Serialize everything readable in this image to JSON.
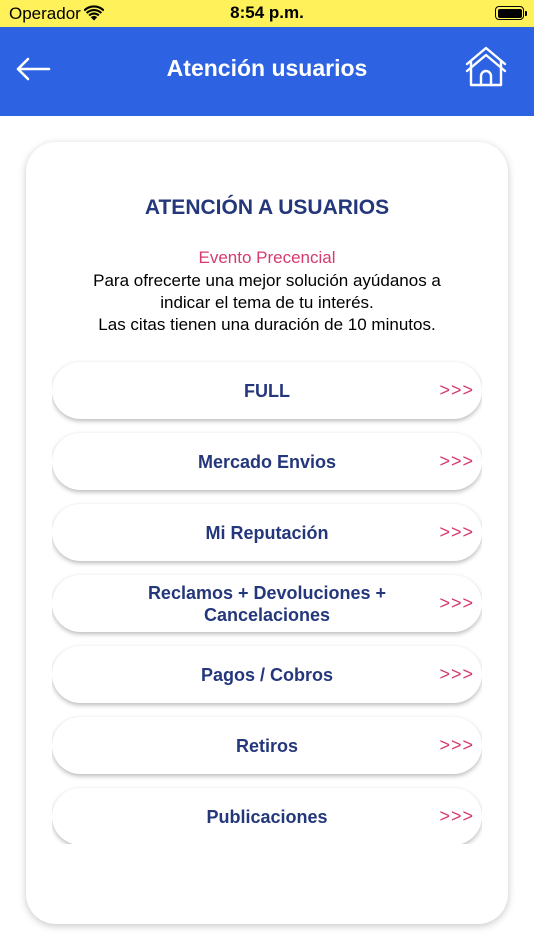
{
  "status_bar": {
    "carrier": "Operador",
    "time": "8:54 p.m."
  },
  "header": {
    "title": "Atención usuarios",
    "back_icon": "arrow-left-icon",
    "home_icon": "home-icon"
  },
  "content": {
    "title": "ATENCIÓN A USUARIOS",
    "subtitle": "Evento Precencial",
    "description_lines": [
      "Para ofrecerte una mejor solución ayúdanos a",
      "indicar el tema de tu interés.",
      "Las citas tienen una duración de 10 minutos."
    ]
  },
  "options": [
    {
      "label_lines": [
        "FULL"
      ],
      "arrow": ">>>"
    },
    {
      "label_lines": [
        "Mercado Envios"
      ],
      "arrow": ">>>"
    },
    {
      "label_lines": [
        "Mi Reputación"
      ],
      "arrow": ">>>"
    },
    {
      "label_lines": [
        "Reclamos + Devoluciones +",
        "Cancelaciones"
      ],
      "arrow": ">>>"
    },
    {
      "label_lines": [
        "Pagos / Cobros"
      ],
      "arrow": ">>>"
    },
    {
      "label_lines": [
        "Retiros"
      ],
      "arrow": ">>>"
    },
    {
      "label_lines": [
        "Publicaciones"
      ],
      "arrow": ">>>"
    }
  ],
  "colors": {
    "status_bar_bg": "#FFF159",
    "header_bg": "#2D63E2",
    "title_text": "#24377B",
    "accent_pink": "#D63A6F"
  }
}
